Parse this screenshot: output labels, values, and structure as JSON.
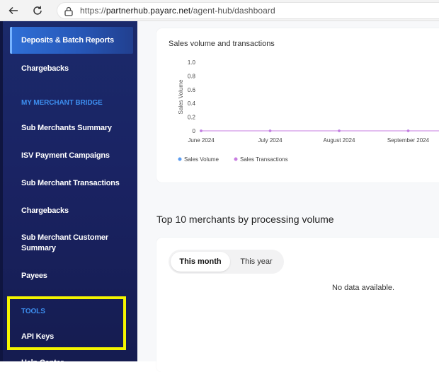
{
  "browser": {
    "url_scheme": "https://",
    "url_host": "partnerhub.payarc.net",
    "url_path": "/agent-hub/dashboard"
  },
  "sidebar": {
    "active_item": "Deposits & Batch Reports",
    "items_top": [
      "Chargebacks"
    ],
    "section_bridge": "MY MERCHANT BRIDGE",
    "bridge_items": [
      "Sub Merchants Summary",
      "ISV Payment Campaigns",
      "Sub Merchant Transactions",
      "Chargebacks",
      "Sub Merchant Customer Summary",
      "Payees"
    ],
    "section_tools": "TOOLS",
    "tools_items": [
      "API Keys",
      "Help Center"
    ]
  },
  "colors": {
    "accent": "#3d8ff0",
    "highlight": "#f5f500",
    "series_volume": "#5b9cf0",
    "series_transactions": "#c77de0"
  },
  "sales_card": {
    "title": "Sales volume and transactions",
    "legend_volume": "Sales Volume",
    "legend_transactions": "Sales Transactions"
  },
  "chart_data": {
    "type": "line",
    "title": "Sales volume and transactions",
    "ylabel": "Sales Volume",
    "xlabel": "",
    "categories": [
      "June 2024",
      "July 2024",
      "August 2024",
      "September 2024"
    ],
    "ylim": [
      0,
      1.0
    ],
    "yticks": [
      "0",
      "0.2",
      "0.4",
      "0.6",
      "0.8",
      "1.0"
    ],
    "grid": false,
    "legend": "bottom-left",
    "series": [
      {
        "name": "Sales Volume",
        "values": [
          0,
          0,
          0,
          0
        ]
      },
      {
        "name": "Sales Transactions",
        "values": [
          0,
          0,
          0,
          0
        ]
      }
    ]
  },
  "merchants": {
    "title": "Top 10 merchants by processing volume",
    "tab_month": "This month",
    "tab_year": "This year",
    "empty": "No data available."
  }
}
